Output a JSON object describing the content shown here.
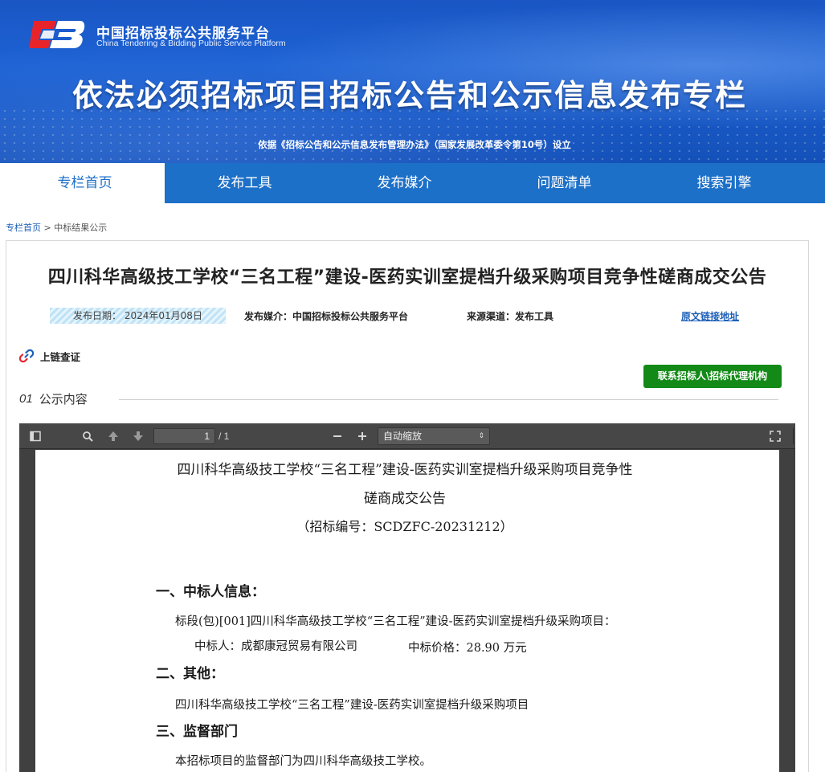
{
  "logo": {
    "cn": "中国招标投标公共服务平台",
    "en": "China Tendering & Bidding Public Service Platform"
  },
  "banner": {
    "title": "依法必须招标项目招标公告和公示信息发布专栏",
    "subtitle": "依据《招标公告和公示信息发布管理办法》（国家发展改革委令第10号）设立"
  },
  "nav": [
    {
      "label": "专栏首页"
    },
    {
      "label": "发布工具"
    },
    {
      "label": "发布媒介"
    },
    {
      "label": "问题清单"
    },
    {
      "label": "搜索引擎"
    }
  ],
  "breadcrumb": {
    "home": "专栏首页",
    "sep": " > ",
    "current": "中标结果公示"
  },
  "article": {
    "title": "四川科华高级技工学校“三名工程”建设-医药实训室提档升级采购项目竞争性磋商成交公告",
    "publish_date": "发布日期：  2024年01月08日",
    "media": "发布媒介：中国招标投标公共服务平台",
    "source": "来源渠道：发布工具",
    "original_link": "原文链接地址",
    "chain_check": "上链查证",
    "contact_button": "联系招标人\\招标代理机构",
    "section_num": "01",
    "section_title": "公示内容"
  },
  "viewer": {
    "page_current": "1",
    "page_total": "/ 1",
    "zoom": "自动缩放"
  },
  "pdf": {
    "title_line1": "四川科华高级技工学校“三名工程”建设-医药实训室提档升级采购项目竞争性",
    "title_line2": "磋商成交公告",
    "bid_no": "（招标编号：SCDZFC-20231212）",
    "h1": "一、中标人信息：",
    "p1": "标段(包)[001]四川科华高级技工学校“三名工程”建设-医药实训室提档升级采购项目：",
    "winner_label": "中标人：成都康冠贸易有限公司",
    "price_label": "中标价格：28.90 万元",
    "h2": "二、其他：",
    "p2": "四川科华高级技工学校“三名工程”建设-医药实训室提档升级采购项目",
    "h3": "三、监督部门",
    "p3": "本招标项目的监督部门为四川科华高级技工学校。"
  },
  "colors": {
    "banner_blue": "#1d62d4",
    "nav_blue": "#1d70c8",
    "button_green": "#138a17",
    "link_blue": "#1d5fb8"
  }
}
